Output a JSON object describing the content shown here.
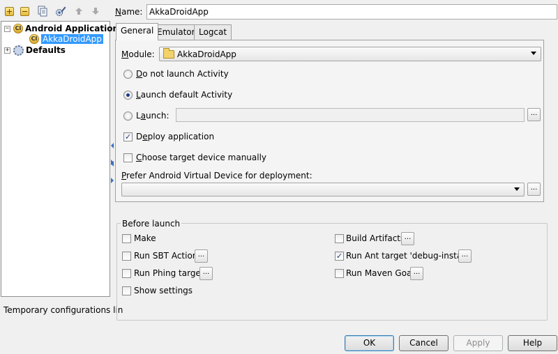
{
  "toolbar": {
    "icons": [
      "add-icon",
      "remove-icon",
      "copy-icon",
      "edit-defaults-icon",
      "move-up-icon",
      "move-down-icon"
    ]
  },
  "tree": {
    "items": [
      {
        "label": "Android Application",
        "bold": true,
        "expanded": true,
        "icon": "android-config-icon"
      },
      {
        "label": "AkkaDroidApp",
        "selected": true,
        "icon": "android-config-icon"
      },
      {
        "label": "Defaults",
        "bold": true,
        "expanded": false,
        "icon": "defaults-icon"
      }
    ]
  },
  "temp_config_text": "Temporary configurations lin",
  "name": {
    "label": "Name:",
    "value": "AkkaDroidApp"
  },
  "tabs": [
    {
      "label": "General",
      "active": true
    },
    {
      "label": "Emulator",
      "active": false
    },
    {
      "label": "Logcat",
      "active": false
    }
  ],
  "general": {
    "module_label": "Module:",
    "module_value": "AkkaDroidApp",
    "radio_do_not_launch": "Do not launch Activity",
    "radio_launch_default": "Launch default Activity",
    "radio_launch": "Launch:",
    "launch_value": "",
    "deploy_label": "Deploy application",
    "choose_target_label": "Choose target device manually",
    "avd_label": "Prefer Android Virtual Device for deployment:",
    "avd_value": "",
    "dots": "..."
  },
  "before_launch": {
    "title": "Before launch",
    "make": "Make",
    "run_sbt": "Run SBT Action",
    "run_phing": "Run Phing target",
    "show_settings": "Show settings",
    "build_artifacts": "Build Artifacts",
    "run_ant": "Run Ant target 'debug-install'",
    "run_maven": "Run Maven Goal"
  },
  "buttons": {
    "ok": "OK",
    "cancel": "Cancel",
    "apply": "Apply",
    "help": "Help"
  },
  "colors": {
    "selection": "#3399ff",
    "background": "#f0f0f0"
  }
}
